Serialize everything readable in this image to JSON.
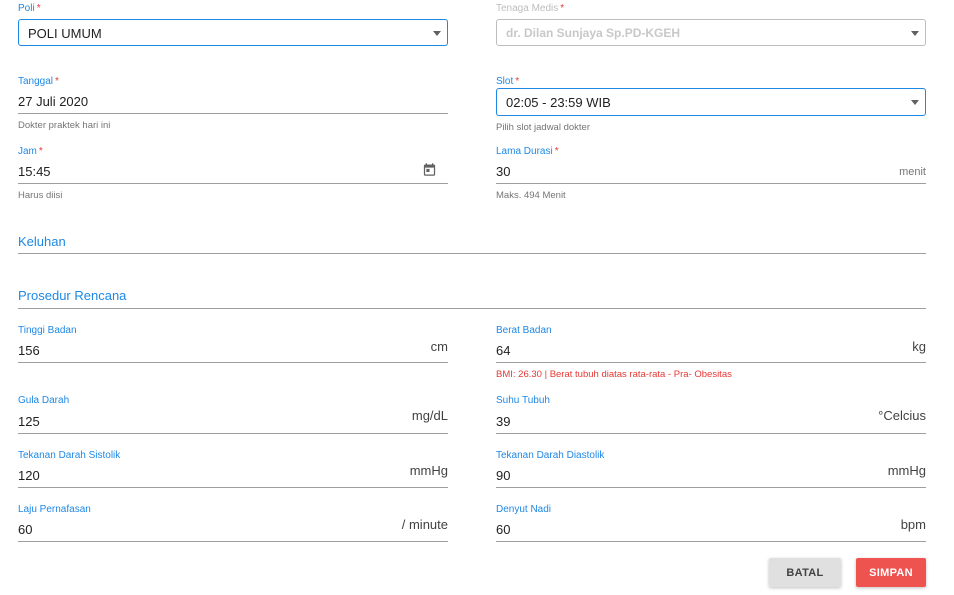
{
  "poli": {
    "label": "Poli",
    "value": "POLI UMUM"
  },
  "tenaga_medis": {
    "label": "Tenaga Medis",
    "value": "dr. Dilan Sunjaya Sp.PD-KGEH"
  },
  "tanggal": {
    "label": "Tanggal",
    "value": "27 Juli 2020",
    "hint": "Dokter praktek hari ini"
  },
  "slot": {
    "label": "Slot",
    "value": "02:05 - 23:59 WIB",
    "hint": "Pilih slot jadwal dokter"
  },
  "jam": {
    "label": "Jam",
    "value": "15:45",
    "hint": "Harus diisi"
  },
  "lama_durasi": {
    "label": "Lama Durasi",
    "value": "30",
    "suffix": "menit",
    "hint": "Maks. 494 Menit"
  },
  "keluhan": {
    "label": "Keluhan"
  },
  "prosedur": {
    "label": "Prosedur Rencana"
  },
  "tinggi_badan": {
    "label": "Tinggi Badan",
    "value": "156",
    "suffix": "cm"
  },
  "berat_badan": {
    "label": "Berat Badan",
    "value": "64",
    "suffix": "kg",
    "bmi_note": "BMI: 26.30 | Berat tubuh diatas rata-rata - Pra- Obesitas"
  },
  "gula_darah": {
    "label": "Gula Darah",
    "value": "125",
    "suffix": "mg/dL"
  },
  "suhu_tubuh": {
    "label": "Suhu Tubuh",
    "value": "39",
    "suffix": "°Celcius"
  },
  "sistolik": {
    "label": "Tekanan Darah Sistolik",
    "value": "120",
    "suffix": "mmHg"
  },
  "diastolik": {
    "label": "Tekanan Darah Diastolik",
    "value": "90",
    "suffix": "mmHg"
  },
  "laju_pernafasan": {
    "label": "Laju Pernafasan",
    "value": "60",
    "suffix": "/ minute"
  },
  "denyut_nadi": {
    "label": "Denyut Nadi",
    "value": "60",
    "suffix": "bpm"
  },
  "actions": {
    "cancel_label": "BATAL",
    "save_label": "SIMPAN"
  },
  "required_mark": "*",
  "colors": {
    "accent": "#1e88e5",
    "error": "#e53935",
    "save_button": "#ef5350",
    "cancel_button": "#e0e0e0"
  }
}
